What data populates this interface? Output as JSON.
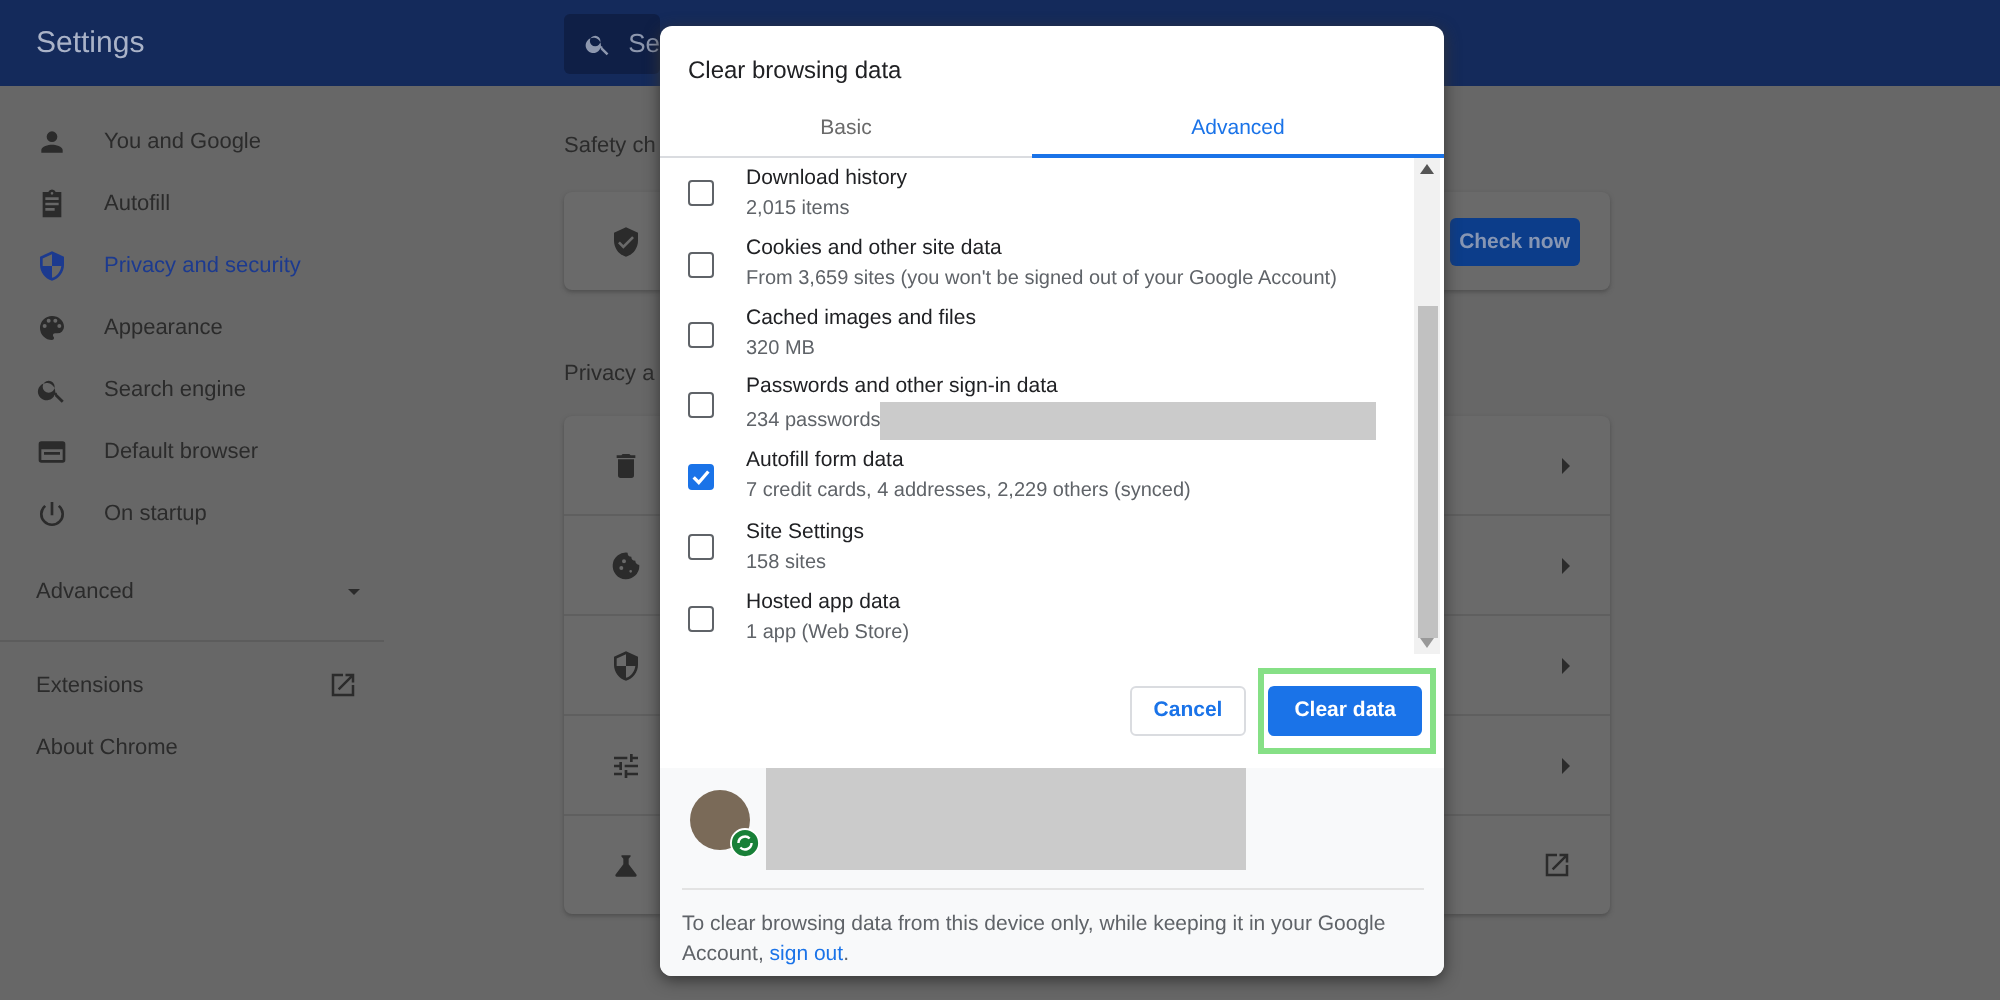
{
  "header": {
    "title": "Settings",
    "search_placeholder": "Se"
  },
  "sidebar": {
    "items": [
      {
        "label": "You and Google",
        "selected": false
      },
      {
        "label": "Autofill",
        "selected": false
      },
      {
        "label": "Privacy and security",
        "selected": true
      },
      {
        "label": "Appearance",
        "selected": false
      },
      {
        "label": "Search engine",
        "selected": false
      },
      {
        "label": "Default browser",
        "selected": false
      },
      {
        "label": "On startup",
        "selected": false
      }
    ],
    "advanced": {
      "label": "Advanced",
      "expanded": false
    },
    "links": [
      {
        "label": "Extensions",
        "kind": "external"
      },
      {
        "label": "About Chrome",
        "kind": "plain"
      }
    ]
  },
  "main": {
    "safety_heading": "Safety ch",
    "safety_button": "Check now",
    "privacy_heading": "Privacy a",
    "rows": [
      {
        "kind": "submenu"
      },
      {
        "kind": "submenu"
      },
      {
        "kind": "submenu"
      },
      {
        "kind": "submenu"
      },
      {
        "kind": "external"
      }
    ]
  },
  "dialog": {
    "title": "Clear browsing data",
    "tabs": [
      {
        "label": "Basic",
        "selected": false
      },
      {
        "label": "Advanced",
        "selected": true
      }
    ],
    "items": [
      {
        "title": "Download history",
        "detail": "2,015 items",
        "checked": false,
        "redacted": false
      },
      {
        "title": "Cookies and other site data",
        "detail": "From 3,659 sites (you won't be signed out of your Google Account)",
        "checked": false,
        "redacted": false
      },
      {
        "title": "Cached images and files",
        "detail": "320 MB",
        "checked": false,
        "redacted": false
      },
      {
        "title": "Passwords and other sign-in data",
        "detail": "234 passwords",
        "checked": false,
        "redacted": true
      },
      {
        "title": "Autofill form data",
        "detail": "7 credit cards, 4 addresses, 2,229 others (synced)",
        "checked": true,
        "redacted": false
      },
      {
        "title": "Site Settings",
        "detail": "158 sites",
        "checked": false,
        "redacted": false
      },
      {
        "title": "Hosted app data",
        "detail": "1 app (Web Store)",
        "checked": false,
        "redacted": false
      }
    ],
    "buttons": [
      {
        "label": "Cancel",
        "kind": "secondary",
        "highlighted": false
      },
      {
        "label": "Clear data",
        "kind": "primary",
        "highlighted": true
      }
    ],
    "account": {
      "redacted": true,
      "synced": true
    },
    "note": "To clear browsing data from this device only, while keeping it in your Google Account, ",
    "note_link": "sign out",
    "note_end": "."
  }
}
